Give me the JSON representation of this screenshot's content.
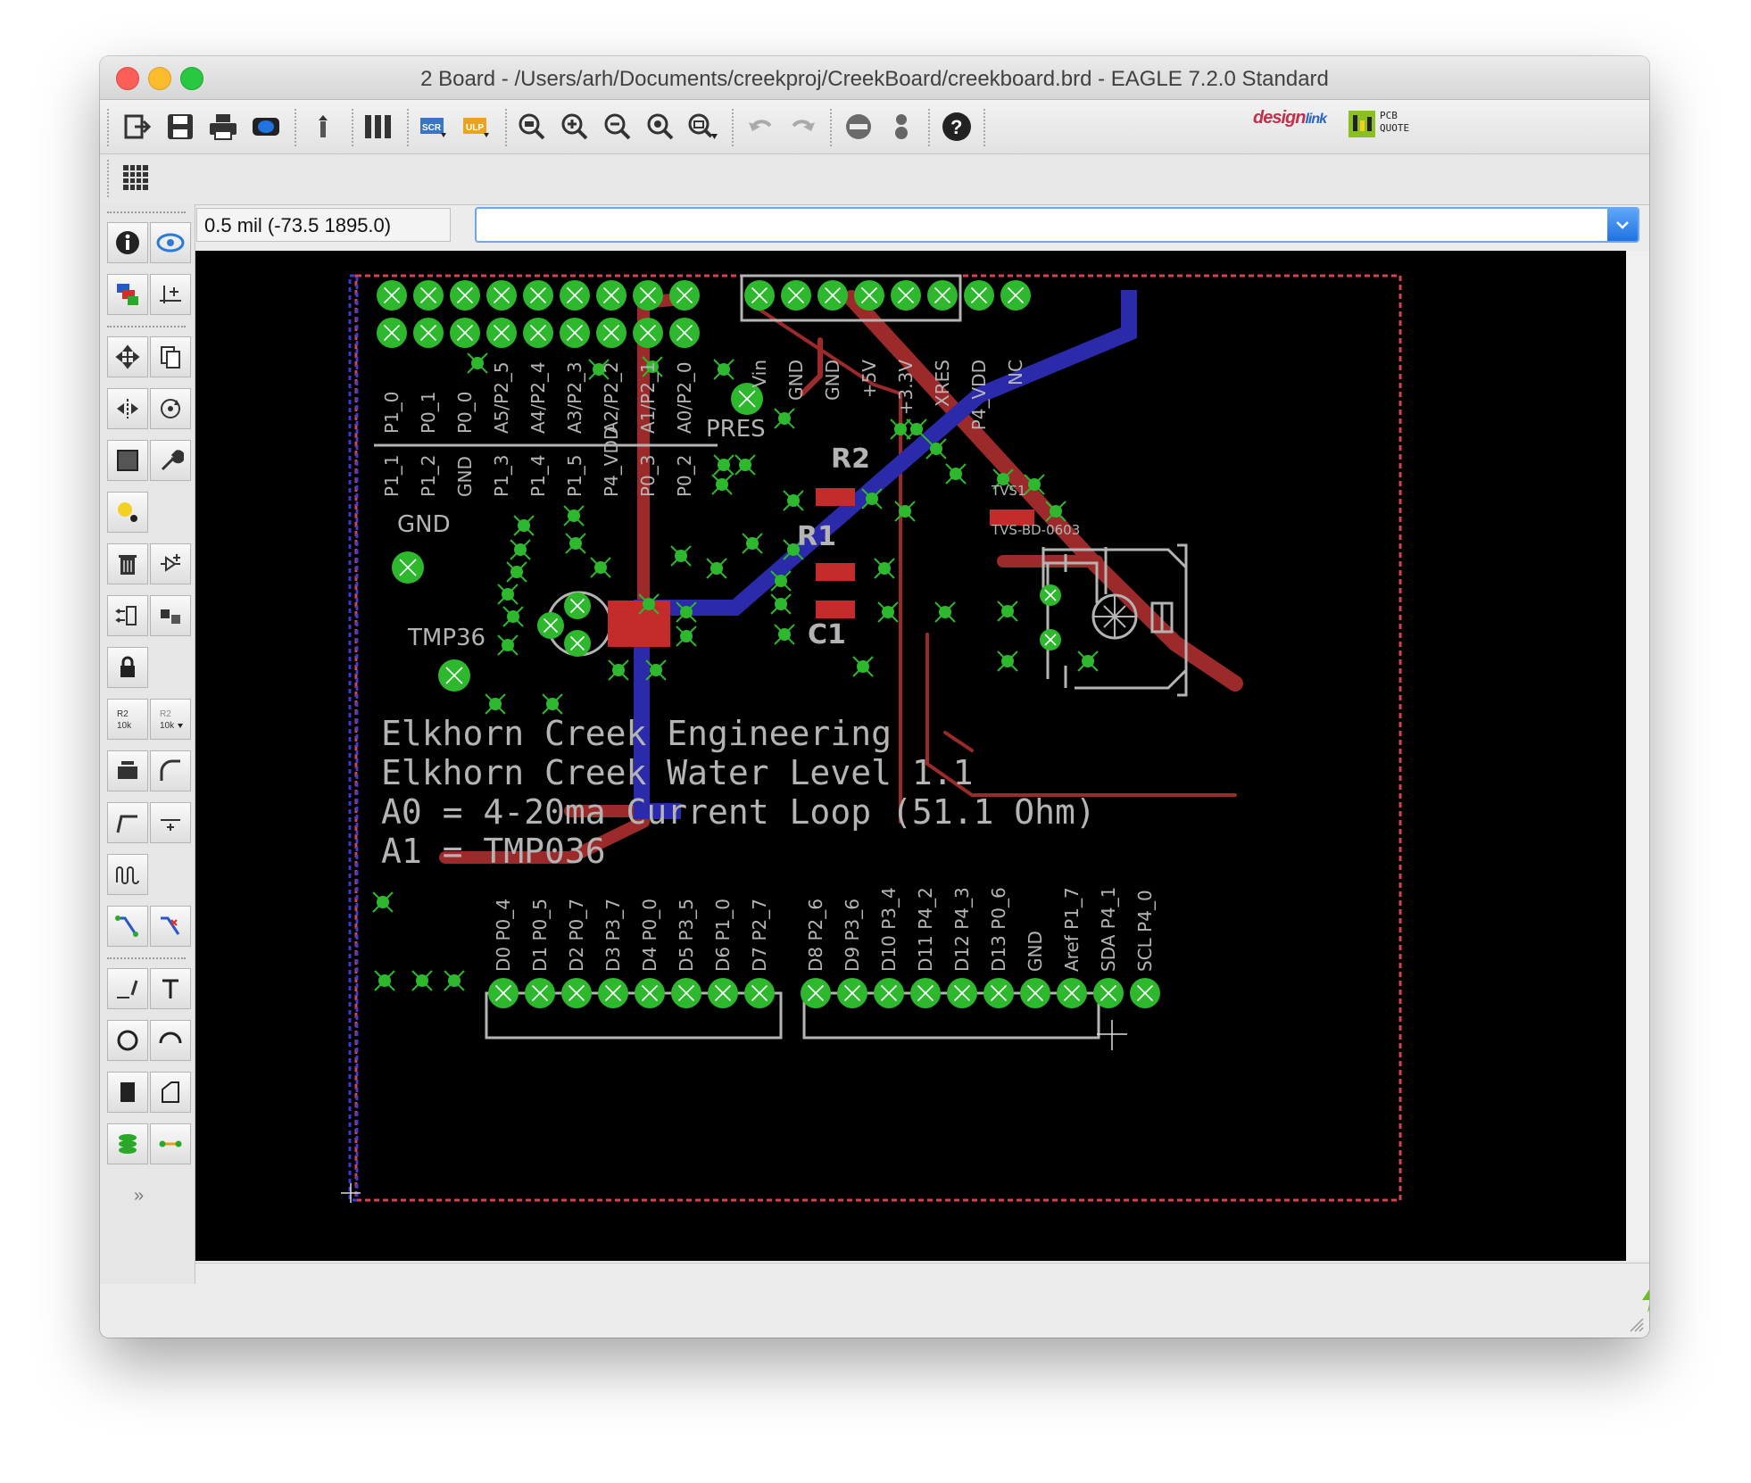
{
  "window": {
    "title": "2 Board - /Users/arh/Documents/creekproj/CreekBoard/creekboard.brd - EAGLE 7.2.0 Standard"
  },
  "toolbar": {
    "buttons": [
      "open-icon",
      "save-icon",
      "print-icon",
      "cam-icon",
      "upload-icon",
      "layers-icon",
      "script-icon",
      "ulp-icon",
      "zoom-fit-icon",
      "zoom-in-icon",
      "zoom-out-icon",
      "zoom-redraw-icon",
      "zoom-select-icon",
      "undo-icon",
      "redo-icon",
      "stop-icon",
      "go-icon",
      "help-icon"
    ],
    "designlink": "design",
    "designlink_sub": "link",
    "pcbquote_line1": "PCB",
    "pcbquote_line2": "QUOTE"
  },
  "coordinate_display": "0.5 mil (-73.5 1895.0)",
  "command_input": "",
  "board": {
    "top_header_labels": [
      "P1_0",
      "P0_1",
      "P0_0",
      "A5/P2_5",
      "A4/P2_4",
      "A3/P2_3",
      "A2/P2_2",
      "A1/P2_1",
      "A0/P2_0"
    ],
    "second_row_labels": [
      "P1_1",
      "P1_2",
      "GND",
      "P1_3",
      "P1_4",
      "P1_5",
      "P4_VDD",
      "P0_3",
      "P0_2"
    ],
    "power_header_labels": [
      "Vin",
      "GND",
      "GND",
      "+5V",
      "+3.3V",
      "XRES",
      "P4_VDD",
      "NC"
    ],
    "part_labels": {
      "pres": "PRES",
      "gnd": "GND",
      "tmp36": "TMP36",
      "r2": "R2",
      "r1": "R1",
      "c1": "C1",
      "tvs1": "TVS1",
      "tvs_pkg": "TVS-BD-0603"
    },
    "silkscreen_lines": [
      "Elkhorn Creek Engineering",
      "Elkhorn Creek Water Level 1.1",
      "A0 = 4-20ma Current Loop (51.1 Ohm)",
      "A1 = TMP036"
    ],
    "bottom_left_labels": [
      "D0 P0_4",
      "D1 P0_5",
      "D2 P0_7",
      "D3 P3_7",
      "D4 P0_0",
      "D5 P3_5",
      "D6 P1_0",
      "D7 P2_7"
    ],
    "bottom_right_labels": [
      "D8 P2_6",
      "D9 P3_6",
      "D10 P3_4",
      "D11 P4_2",
      "D12 P4_3",
      "D13 P0_6",
      "GND",
      "Aref P1_7",
      "SDA P4_1",
      "SCL P4_0"
    ]
  },
  "colors": {
    "board_bg": "#000000",
    "pad": "#2db82d",
    "top_trace": "#9c2a2a",
    "bottom_trace": "#2a2aaa",
    "silk": "#b4b4b4",
    "dimension": "#d94050",
    "accent": "#1f73e2"
  }
}
